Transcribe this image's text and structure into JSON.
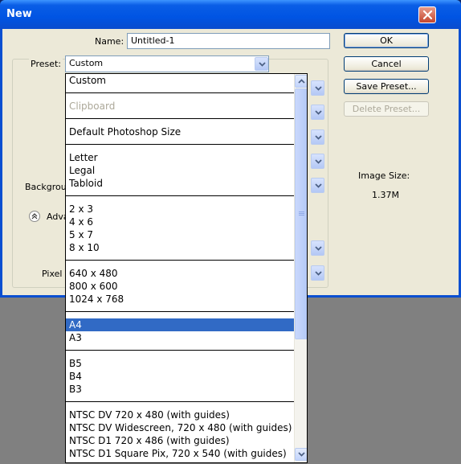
{
  "window": {
    "title": "New",
    "close_icon": "close-icon"
  },
  "form": {
    "name_label": "Name:",
    "name_value": "Untitled-1",
    "preset_label": "Preset:",
    "preset_value": "Custom",
    "background_label": "Backgrou",
    "advanced_label": "Adva",
    "pixel_label": "Pixel"
  },
  "buttons": {
    "ok": "OK",
    "cancel": "Cancel",
    "save_preset": "Save Preset...",
    "delete_preset": "Delete Preset..."
  },
  "image_size": {
    "label": "Image Size:",
    "value": "1.37M"
  },
  "dropdown": {
    "groups": [
      [
        {
          "label": "Custom"
        }
      ],
      [
        {
          "label": "Clipboard",
          "disabled": true
        }
      ],
      [
        {
          "label": "Default Photoshop Size"
        }
      ],
      [
        {
          "label": "Letter"
        },
        {
          "label": "Legal"
        },
        {
          "label": "Tabloid"
        }
      ],
      [
        {
          "label": "2 x 3"
        },
        {
          "label": "4 x 6"
        },
        {
          "label": "5 x 7"
        },
        {
          "label": "8 x 10"
        }
      ],
      [
        {
          "label": "640 x 480"
        },
        {
          "label": "800 x 600"
        },
        {
          "label": "1024 x 768"
        }
      ],
      [
        {
          "label": "A4",
          "selected": true
        },
        {
          "label": "A3"
        }
      ],
      [
        {
          "label": "B5"
        },
        {
          "label": "B4"
        },
        {
          "label": "B3"
        }
      ],
      [
        {
          "label": "NTSC DV 720 x 480 (with guides)"
        },
        {
          "label": "NTSC DV Widescreen, 720 x 480 (with guides)"
        },
        {
          "label": "NTSC D1 720 x 486 (with guides)"
        },
        {
          "label": "NTSC D1 Square Pix, 720 x 540 (with guides)"
        }
      ]
    ]
  },
  "colors": {
    "selection": "#316ac5",
    "titlebar": "#0054e3",
    "dialog_bg": "#ece9d8"
  }
}
